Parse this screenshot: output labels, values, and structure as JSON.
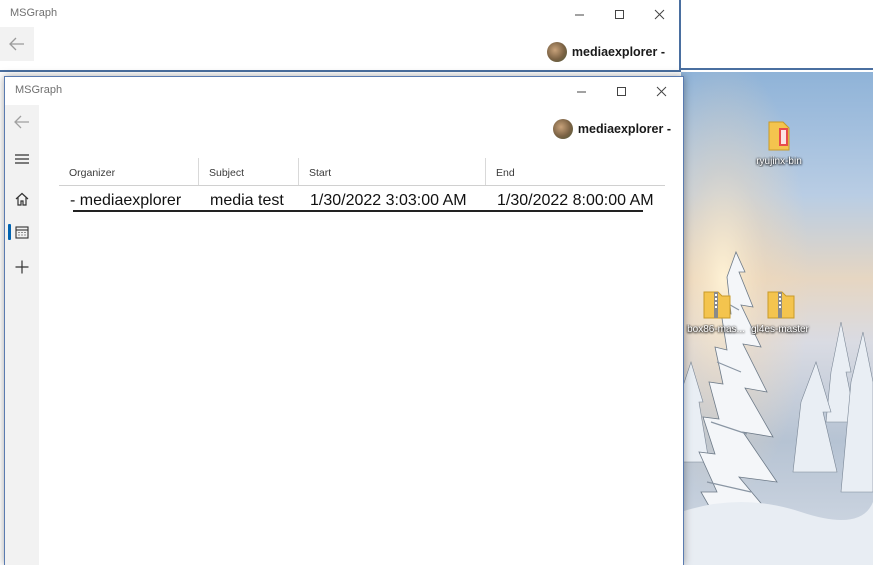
{
  "back_window": {
    "title": "MSGraph",
    "user_name": "mediaexplorer -"
  },
  "front_window": {
    "title": "MSGraph",
    "user_name": "mediaexplorer -",
    "nav": [
      {
        "icon": "hamburger-menu-icon"
      },
      {
        "icon": "home-icon"
      },
      {
        "icon": "calendar-icon",
        "selected": true
      },
      {
        "icon": "plus-icon"
      }
    ],
    "table": {
      "columns": [
        "Organizer",
        "Subject",
        "Start",
        "End"
      ],
      "rows": [
        {
          "organizer": "- mediaexplorer",
          "subject": "media test",
          "start": "1/30/2022 3:03:00 AM",
          "end": "1/30/2022 8:00:00 AM"
        }
      ]
    }
  },
  "desktop": {
    "icons": [
      {
        "label": "ryujinx-bin",
        "icon": "folder-icon"
      },
      {
        "label": "box86-mas...",
        "icon": "zip-folder-icon"
      },
      {
        "label": "gl4es-master",
        "icon": "zip-folder-icon"
      }
    ]
  },
  "colors": {
    "accent": "#0063b1",
    "window_border": "#4a6fa0",
    "nav_background": "#f2f2f2"
  }
}
